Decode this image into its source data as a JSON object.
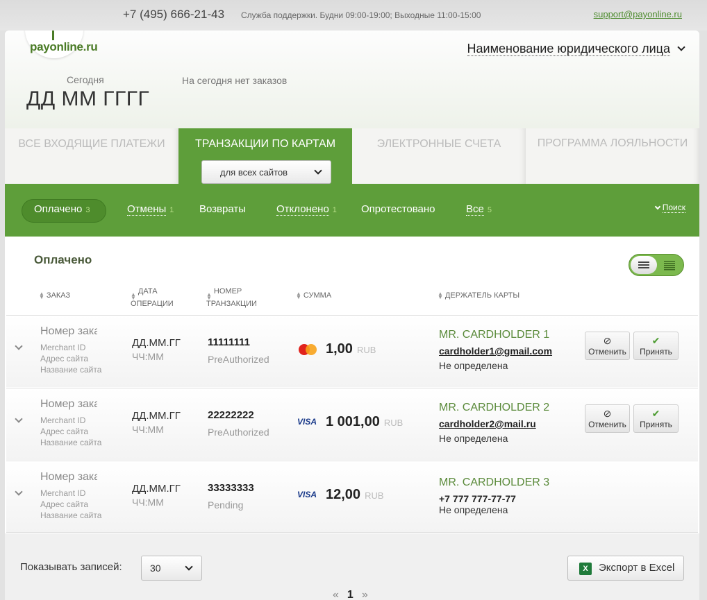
{
  "top": {
    "phone": "+7 (495) 666-21-43",
    "support": "Служба поддержки. Будни 09:00-19:00; Выходные 11:00-15:00",
    "email": "support@payonline.ru"
  },
  "brand": {
    "logo_part1": "pay",
    "logo_part2": "online.ru"
  },
  "header": {
    "legal_entity": "Наименование юридического лица",
    "today_label": "Сегодня",
    "today_date": "ДД ММ ГГГГ",
    "no_orders": "На сегодня нет заказов"
  },
  "tabs": [
    {
      "label": "ВСЕ ВХОДЯЩИЕ ПЛАТЕЖИ"
    },
    {
      "label": "ТРАНЗАКЦИИ ПО КАРТАМ"
    },
    {
      "label": "ЭЛЕКТРОННЫЕ СЧЕТА"
    },
    {
      "label": "ПРОГРАММА ЛОЯЛЬНОСТИ"
    }
  ],
  "site_select": "для всех сайтов",
  "filters": [
    {
      "label": "Оплачено",
      "count": "3"
    },
    {
      "label": "Отмены",
      "count": "1"
    },
    {
      "label": "Возвраты",
      "count": ""
    },
    {
      "label": "Отклонено",
      "count": "1"
    },
    {
      "label": "Опротестовано",
      "count": ""
    },
    {
      "label": "Все",
      "count": "5"
    }
  ],
  "search_label": "Поиск",
  "section_title": "Оплачено",
  "columns": {
    "order": "ЗАКАЗ",
    "date_l1": "ДАТА",
    "date_l2": "ОПЕРАЦИИ",
    "txn_l1": "НОМЕР",
    "txn_l2": "ТРАНЗАКЦИИ",
    "amount": "СУММА",
    "holder": "ДЕРЖАТЕЛЬ КАРТЫ"
  },
  "rows": [
    {
      "order": "Номер заказа",
      "merchant": "Merchant ID",
      "site_addr": "Адрес сайта",
      "site_name": "Название сайта",
      "date": "ДД.ММ.ГГ",
      "time": "ЧЧ:ММ",
      "txn": "11111111",
      "status": "PreAuthorized",
      "card": "mastercard",
      "amount": "1,00",
      "currency": "RUB",
      "holder": "MR. CARDHOLDER 1",
      "contact": "cardholder1@gmail.com",
      "holder_status": "Не определена",
      "cancel": "Отменить",
      "accept": "Принять"
    },
    {
      "order": "Номер заказа",
      "merchant": "Merchant ID",
      "site_addr": "Адрес сайта",
      "site_name": "Название сайта",
      "date": "ДД.ММ.ГГ",
      "time": "ЧЧ:ММ",
      "txn": "22222222",
      "status": "PreAuthorized",
      "card": "visa",
      "amount": "1 001,00",
      "currency": "RUB",
      "holder": "MR. CARDHOLDER 2",
      "contact": "cardholder2@mail.ru",
      "holder_status": "Не определена",
      "cancel": "Отменить",
      "accept": "Принять"
    },
    {
      "order": "Номер заказа",
      "merchant": "Merchant ID",
      "site_addr": "Адрес сайта",
      "site_name": "Название сайта",
      "date": "ДД.ММ.ГГ",
      "time": "ЧЧ:ММ",
      "txn": "33333333",
      "status": "Pending",
      "card": "visa",
      "amount": "12,00",
      "currency": "RUB",
      "holder": "MR. CARDHOLDER 3",
      "contact": "+7 777 777-77-77",
      "holder_status": "Не определена"
    }
  ],
  "bottom": {
    "per_page_label": "Показывать записей:",
    "per_page_value": "30",
    "export": "Экспорт в Excel",
    "export_icon": "X",
    "prev": "«",
    "page": "1",
    "next": "»"
  },
  "icons": {
    "visa": "VISA"
  },
  "colors": {
    "green": "#5e9e3a",
    "holder": "#5a8a3a"
  }
}
